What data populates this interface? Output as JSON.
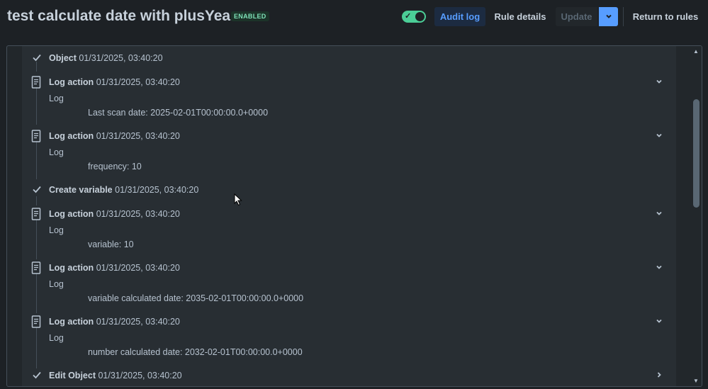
{
  "header": {
    "title": "test calculate date with plusYears",
    "status_badge": "ENABLED",
    "audit_log_label": "Audit log",
    "rule_details_label": "Rule details",
    "update_label": "Update",
    "return_label": "Return to rules"
  },
  "entries": [
    {
      "type": "check",
      "name": "Object",
      "time": "01/31/2025, 03:40:20"
    },
    {
      "type": "log",
      "name": "Log action",
      "time": "01/31/2025, 03:40:20",
      "sub": "Log",
      "detail": "Last scan date: 2025-02-01T00:00:00.0+0000"
    },
    {
      "type": "log",
      "name": "Log action",
      "time": "01/31/2025, 03:40:20",
      "sub": "Log",
      "detail": "frequency: 10"
    },
    {
      "type": "check",
      "name": "Create variable",
      "time": "01/31/2025, 03:40:20"
    },
    {
      "type": "log",
      "name": "Log action",
      "time": "01/31/2025, 03:40:20",
      "sub": "Log",
      "detail": "variable: 10"
    },
    {
      "type": "log",
      "name": "Log action",
      "time": "01/31/2025, 03:40:20",
      "sub": "Log",
      "detail": "variable calculated date: 2035-02-01T00:00:00.0+0000"
    },
    {
      "type": "log",
      "name": "Log action",
      "time": "01/31/2025, 03:40:20",
      "sub": "Log",
      "detail": "number calculated date: 2032-02-01T00:00:00.0+0000"
    },
    {
      "type": "check",
      "name": "Edit Object",
      "time": "01/31/2025, 03:40:20"
    }
  ],
  "colors": {
    "background": "#1d2125",
    "accent": "#579dff",
    "enabled_green": "#4bce97"
  }
}
